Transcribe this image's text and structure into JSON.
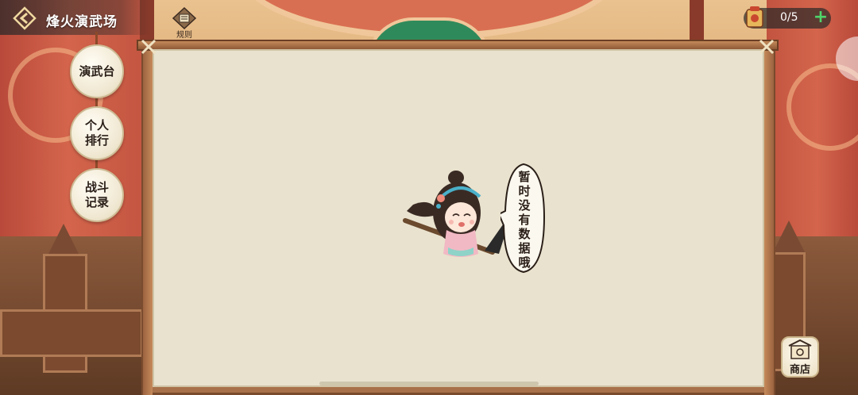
{
  "header": {
    "title": "烽火演武场",
    "rules_label": "规则"
  },
  "currency": {
    "count": "0/5",
    "add_label": "+"
  },
  "sidebar": {
    "items": [
      {
        "label": "演武台"
      },
      {
        "label": "个人排行"
      },
      {
        "label": "战斗记录"
      }
    ]
  },
  "empty_state": {
    "message": "暂时没有数据哦"
  },
  "shop": {
    "label": "商店"
  },
  "colors": {
    "board": "#e9e2ce",
    "wood": "#a8714a",
    "curtain": "#c25440",
    "plus": "#4fd46a"
  }
}
